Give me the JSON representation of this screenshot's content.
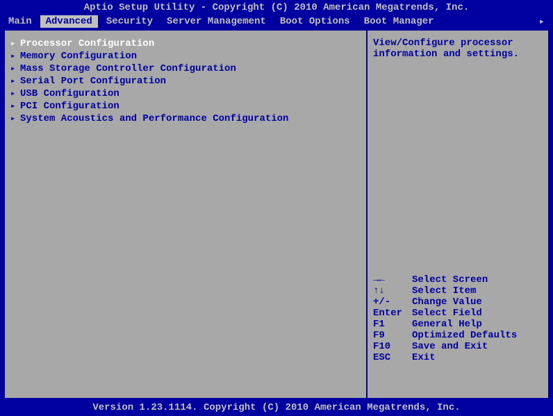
{
  "title": "Aptio Setup Utility - Copyright (C) 2010 American Megatrends, Inc.",
  "tabs": [
    {
      "label": "Main",
      "active": false
    },
    {
      "label": "Advanced",
      "active": true
    },
    {
      "label": "Security",
      "active": false
    },
    {
      "label": "Server Management",
      "active": false
    },
    {
      "label": "Boot Options",
      "active": false
    },
    {
      "label": "Boot Manager",
      "active": false
    }
  ],
  "tab_arrow": "▸",
  "menu_items": [
    {
      "label": "Processor Configuration",
      "selected": true
    },
    {
      "label": "Memory Configuration",
      "selected": false
    },
    {
      "label": "Mass Storage Controller Configuration",
      "selected": false
    },
    {
      "label": "Serial Port Configuration",
      "selected": false
    },
    {
      "label": "USB Configuration",
      "selected": false
    },
    {
      "label": "PCI Configuration",
      "selected": false
    },
    {
      "label": "System Acoustics and Performance Configuration",
      "selected": false
    }
  ],
  "menu_arrow": "▸",
  "help": {
    "line1": "View/Configure processor",
    "line2": "information and settings."
  },
  "keys": [
    {
      "key": "→←",
      "desc": "Select Screen"
    },
    {
      "key": "↑↓",
      "desc": "Select Item"
    },
    {
      "key": "+/-",
      "desc": "Change Value"
    },
    {
      "key": "Enter",
      "desc": "Select Field"
    },
    {
      "key": "F1",
      "desc": "General Help"
    },
    {
      "key": "F9",
      "desc": "Optimized Defaults"
    },
    {
      "key": "F10",
      "desc": "Save and Exit"
    },
    {
      "key": "ESC",
      "desc": "Exit"
    }
  ],
  "footer": "Version 1.23.1114. Copyright (C) 2010 American Megatrends, Inc."
}
